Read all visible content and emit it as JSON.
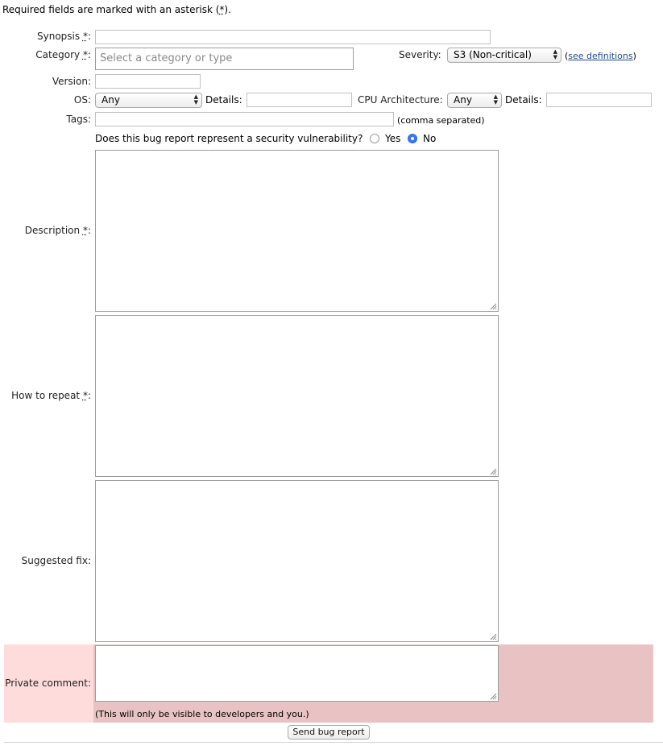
{
  "intro": {
    "text_before": "Required fields are marked with an asterisk (",
    "asterisk": "*",
    "text_after": ")."
  },
  "fields": {
    "synopsis": {
      "label": "Synopsis",
      "asterisk": "*",
      "colon": ":",
      "value": ""
    },
    "category": {
      "label": "Category",
      "asterisk": "*",
      "colon": ":",
      "placeholder": "Select a category or type"
    },
    "severity": {
      "label": "Severity:",
      "selected": "S3 (Non-critical)",
      "link_open": "(",
      "link_text": "see definitions",
      "link_close": ")"
    },
    "version": {
      "label": "Version:",
      "value": ""
    },
    "os": {
      "label": "OS:",
      "selected": "Any",
      "details_label": "Details:"
    },
    "cpu": {
      "label": "CPU Architecture:",
      "selected": "Any",
      "details_label": "Details:"
    },
    "tags": {
      "label": "Tags:",
      "hint": "(comma separated)"
    },
    "security": {
      "question": "Does this bug report represent a security vulnerability?",
      "yes": "Yes",
      "no": "No",
      "selected": "No"
    },
    "description": {
      "label": "Description",
      "asterisk": "*",
      "colon": ":"
    },
    "how_to_repeat": {
      "label": "How to repeat",
      "asterisk": "*",
      "colon": ":"
    },
    "suggested_fix": {
      "label": "Suggested fix:"
    },
    "private_comment": {
      "label": "Private comment:",
      "note": "(This will only be visible to developers and you.)"
    }
  },
  "submit": {
    "label": "Send bug report"
  },
  "colors": {
    "private_label_bg": "#ffdcdc",
    "private_field_bg": "#e9c3c3",
    "radio_accent": "#3478f6",
    "link": "#1a4b8c"
  },
  "icons": {
    "select_arrow": "select-arrow-icon",
    "resize": "resize-grip-icon"
  }
}
